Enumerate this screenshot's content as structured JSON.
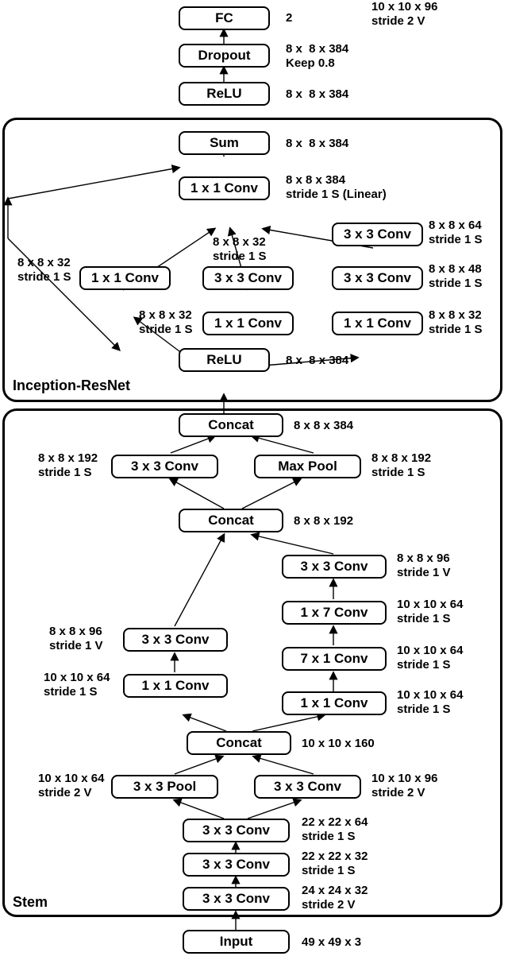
{
  "top": {
    "fc": "FC",
    "fc_ann": "2",
    "dropout": "Dropout",
    "dropout_ann": "8 x  8 x 384\nKeep 0.8",
    "relu": "ReLU",
    "relu_ann": "8 x  8 x 384"
  },
  "ir": {
    "group_label": "Inception-ResNet",
    "sum": "Sum",
    "sum_ann": "8 x  8 x 384",
    "conv1x1_top": "1 x 1 Conv",
    "conv1x1_top_ann": "8 x 8 x 384\nstride 1 S (Linear)",
    "conv3x3_right_top": "3 x 3 Conv",
    "conv3x3_right_top_ann": "8 x 8 x 64\nstride 1 S",
    "conv1x1_left": "1 x 1 Conv",
    "conv1x1_left_ann": "8 x 8 x 32\nstride 1 S",
    "conv3x3_mid": "3 x 3 Conv",
    "conv3x3_mid_ann": "8 x 8 x 32\nstride 1 S",
    "conv3x3_right_bot": "3 x 3 Conv",
    "conv3x3_right_bot_ann": "8 x 8 x 48\nstride 1 S",
    "conv1x1_mid_bot": "1 x 1 Conv",
    "conv1x1_mid_bot_ann": "8 x 8 x 32\nstride 1 S",
    "conv1x1_right_bot": "1 x 1 Conv",
    "conv1x1_right_bot_ann": "8 x 8 x 32\nstride 1 S",
    "relu": "ReLU",
    "relu_ann": "8 x  8 x 384"
  },
  "stem": {
    "group_label": "Stem",
    "concat_top": "Concat",
    "concat_top_ann": "8 x 8 x 384",
    "conv3x3_tl": "3 x 3 Conv",
    "conv3x3_tl_ann": "8 x 8 x 192\nstride 1 S",
    "maxpool": "Max Pool",
    "maxpool_ann": "8 x 8 x 192\nstride 1 S",
    "concat_mid": "Concat",
    "concat_mid_ann": "8 x 8 x 192",
    "r_conv3x3_a": "3 x 3 Conv",
    "r_conv3x3_a_ann": "8 x 8 x 96\nstride 1 V",
    "r_conv1x7": "1 x 7 Conv",
    "r_conv1x7_ann": "10 x 10 x 64\nstride 1 S",
    "r_conv7x1": "7 x 1 Conv",
    "r_conv7x1_ann": "10 x 10 x 64\nstride 1 S",
    "l_conv3x3": "3 x 3 Conv",
    "l_conv3x3_ann": "8 x 8 x 96\nstride 1 V",
    "l_conv1x1": "1 x 1 Conv",
    "l_conv1x1_ann": "10 x 10 x 64\nstride 1 S",
    "r_conv1x1": "1 x 1 Conv",
    "r_conv1x1_ann": "10 x 10 x 64\nstride 1 S",
    "concat_low": "Concat",
    "concat_low_ann": "10 x 10 x 160",
    "pool3x3": "3 x 3 Pool",
    "pool3x3_ann": "10 x 10 x 64\nstride 2 V",
    "conv3x3_low": "3 x 3 Conv",
    "conv3x3_low_ann": "10 x 10 x 96\nstride 2 V",
    "conv3x3_s1": "3 x 3 Conv",
    "conv3x3_s1_ann": "22 x 22 x 64\nstride 1 S",
    "conv3x3_s2": "3 x 3 Conv",
    "conv3x3_s2_ann": "22 x 22 x 32\nstride 1 S",
    "conv3x3_s3": "3 x 3 Conv",
    "conv3x3_s3_ann": "24 x 24 x 32\nstride 2 V"
  },
  "input": {
    "label": "Input",
    "ann": "49 x 49 x 3"
  }
}
